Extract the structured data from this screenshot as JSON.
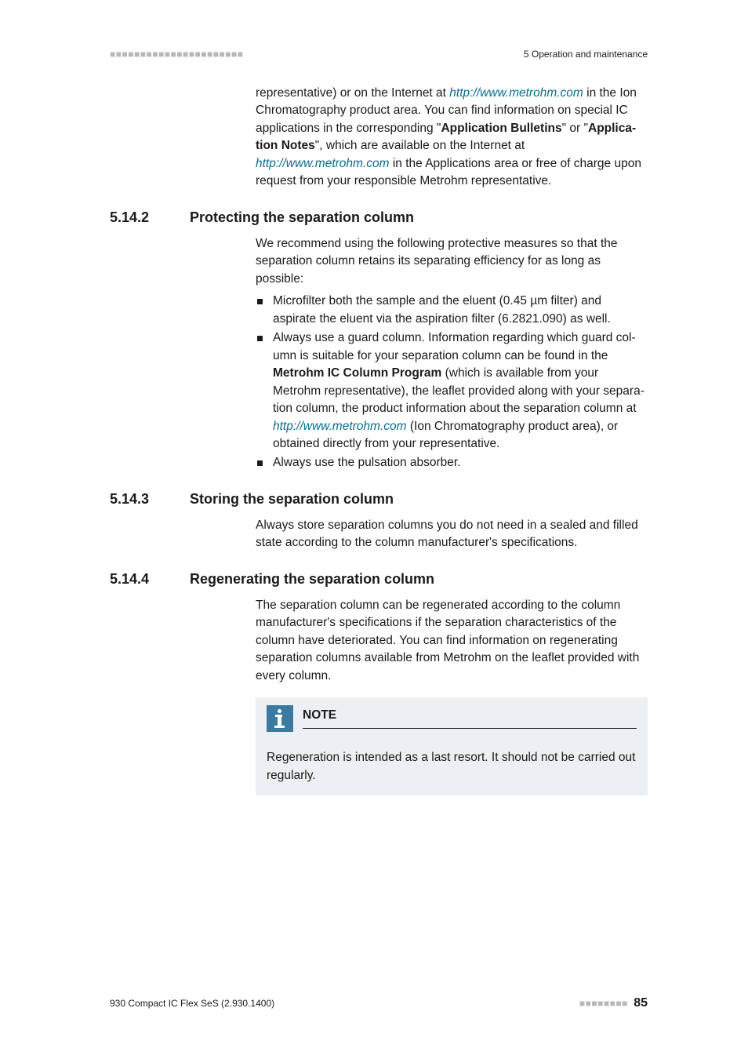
{
  "header": {
    "dashes": "■■■■■■■■■■■■■■■■■■■■■■",
    "chapter": "5 Operation and maintenance"
  },
  "intro": {
    "pre": "representative) or on the Internet at ",
    "link1": "http://www.metrohm.com",
    "mid1": " in the Ion Chromatography product area. You can find information on special IC applications in the corresponding \"",
    "b1": "Application Bulletins",
    "mid2": "\" or \"",
    "b2": "Applica­tion Notes",
    "mid3": "\", which are available on the Internet at ",
    "link2": "http://www.metrohm.com",
    "post": " in the Applications area or free of charge upon request from your responsible Metrohm representative."
  },
  "s2": {
    "num": "5.14.2",
    "title": "Protecting the separation column",
    "para": "We recommend using the following protective measures so that the sepa­ration column retains its separating efficiency for as long as possible:",
    "li1": "Microfilter both the sample and the eluent (0.45 µm filter) and aspirate the eluent via the aspiration filter (6.2821.090) as well.",
    "li2_pre": "Always use a guard column. Information regarding which guard col­umn is suitable for your separation column can be found in the ",
    "li2_b": "Metrohm IC Column Program",
    "li2_mid": " (which is available from your Metrohm representative), the leaflet provided along with your separa­tion column, the product information about the separation column at ",
    "li2_link": "http://www.metrohm.com",
    "li2_post": " (Ion Chromatography product area), or obtained directly from your representative.",
    "li3": "Always use the pulsation absorber."
  },
  "s3": {
    "num": "5.14.3",
    "title": "Storing the separation column",
    "para": "Always store separation columns you do not need in a sealed and filled state according to the column manufacturer's specifications."
  },
  "s4": {
    "num": "5.14.4",
    "title": "Regenerating the separation column",
    "para": "The separation column can be regenerated according to the column man­ufacturer's specifications if the separation characteristics of the column have deteriorated. You can find information on regenerating separation columns available from Metrohm on the leaflet provided with every col­umn."
  },
  "note": {
    "title": "NOTE",
    "body": "Regeneration is intended as a last resort. It should not be carried out regularly."
  },
  "footer": {
    "doc": "930 Compact IC Flex SeS (2.930.1400)",
    "dashes": "■■■■■■■■",
    "page": "85"
  }
}
